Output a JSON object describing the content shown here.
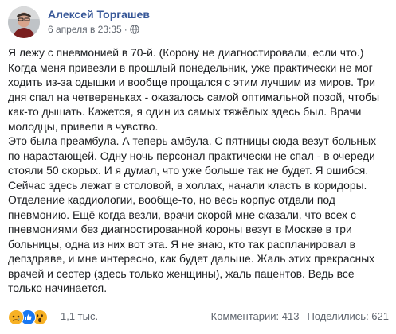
{
  "post": {
    "author": "Алексей Торгашев",
    "timestamp": "6 апреля в 23:35",
    "separator": "·",
    "privacy_icon": "globe-icon",
    "paragraphs": [
      "Я лежу с пневмонией в 70-й. (Корону не диагностировали, если что.)\nКогда меня привезли в прошлый понедельник, уже практически не мог ходить из-за одышки и вообще прощался с этим лучшим из миров. Три дня спал на четвереньках - оказалось самой оптимальной позой, чтобы как-то дышать. Кажется, я один из самых тяжёлых здесь был. Врачи молодцы, привели в чувство.",
      "Это была преамбула. А теперь амбула. С пятницы сюда везут больных по нарастающей. Одну ночь персонал практически не спал - в очереди стояли 50 скорых. И я думал, что уже больше так не будет. Я ошибся. Сейчас здесь лежат в столовой, в холлах, начали класть в коридоры. Отделение кардиологии, вообще-то, но весь корпус отдали под пневмонию. Ещё когда везли, врачи скорой мне сказали, что всех с пневмониями без диагностированной короны везут в Москве в три больницы, одна из них вот эта. Я не знаю, кто так распланировал в депздраве, и мне интересно, как будет дальше. Жаль этих прекрасных врачей и сестер (здесь только женщины), жаль пацентов. Ведь все только начинается."
    ]
  },
  "footer": {
    "reactions": [
      "sad",
      "like",
      "wow"
    ],
    "reaction_count": "1,1 тыс.",
    "comments": "Комментарии: 413",
    "shares": "Поделились: 621"
  },
  "colors": {
    "author_link": "#385898",
    "meta": "#616770",
    "text": "#1c1e21",
    "like": "#1877f2",
    "emoji": "#f7b125"
  }
}
